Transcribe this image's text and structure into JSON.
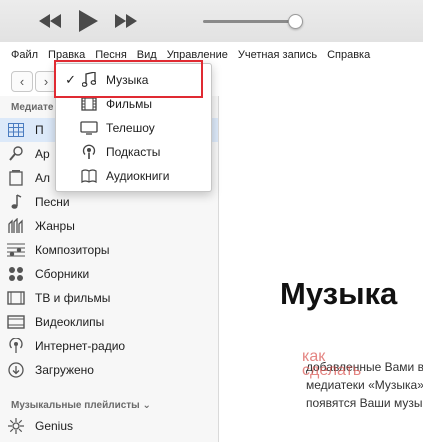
{
  "player": {
    "buttons": [
      "rewind-icon",
      "play-icon",
      "fast-forward-icon"
    ]
  },
  "menubar": {
    "items": [
      "Файл",
      "Правка",
      "Песня",
      "Вид",
      "Управление",
      "Учетная запись",
      "Справка"
    ]
  },
  "nav": {
    "back": "‹",
    "forward": "›"
  },
  "sidebar": {
    "library_title": "Медиате",
    "items": [
      {
        "label": "П",
        "icon": "grid-icon"
      },
      {
        "label": "Ар",
        "icon": "microphone-icon"
      },
      {
        "label": "Ал",
        "icon": "album-icon"
      },
      {
        "label": "Песни",
        "icon": "note-icon"
      },
      {
        "label": "Жанры",
        "icon": "genres-icon"
      },
      {
        "label": "Композиторы",
        "icon": "composers-icon"
      },
      {
        "label": "Сборники",
        "icon": "compilations-icon"
      },
      {
        "label": "ТВ и фильмы",
        "icon": "tv-icon"
      },
      {
        "label": "Видеоклипы",
        "icon": "video-icon"
      },
      {
        "label": "Интернет-радио",
        "icon": "radio-icon"
      },
      {
        "label": "Загружено",
        "icon": "download-icon"
      }
    ],
    "playlists_title": "Музыкальные плейлисты ⌄",
    "playlist_items": [
      {
        "label": "Genius",
        "icon": "genius-icon"
      }
    ]
  },
  "dropdown": {
    "items": [
      {
        "label": "Музыка",
        "icon": "music-note-icon",
        "checked": "✓"
      },
      {
        "label": "Фильмы",
        "icon": "film-icon",
        "checked": ""
      },
      {
        "label": "Телешоу",
        "icon": "tv-icon",
        "checked": ""
      },
      {
        "label": "Подкасты",
        "icon": "podcast-icon",
        "checked": ""
      },
      {
        "label": "Аудиокниги",
        "icon": "audiobook-icon",
        "checked": ""
      }
    ]
  },
  "main": {
    "heading": "Музыка",
    "desc_lines": [
      "добавленные Вами в",
      "медиатеки «Музыка»",
      "появятся Ваши музы"
    ]
  },
  "watermark": {
    "line1": "как",
    "line2": "сделать"
  }
}
